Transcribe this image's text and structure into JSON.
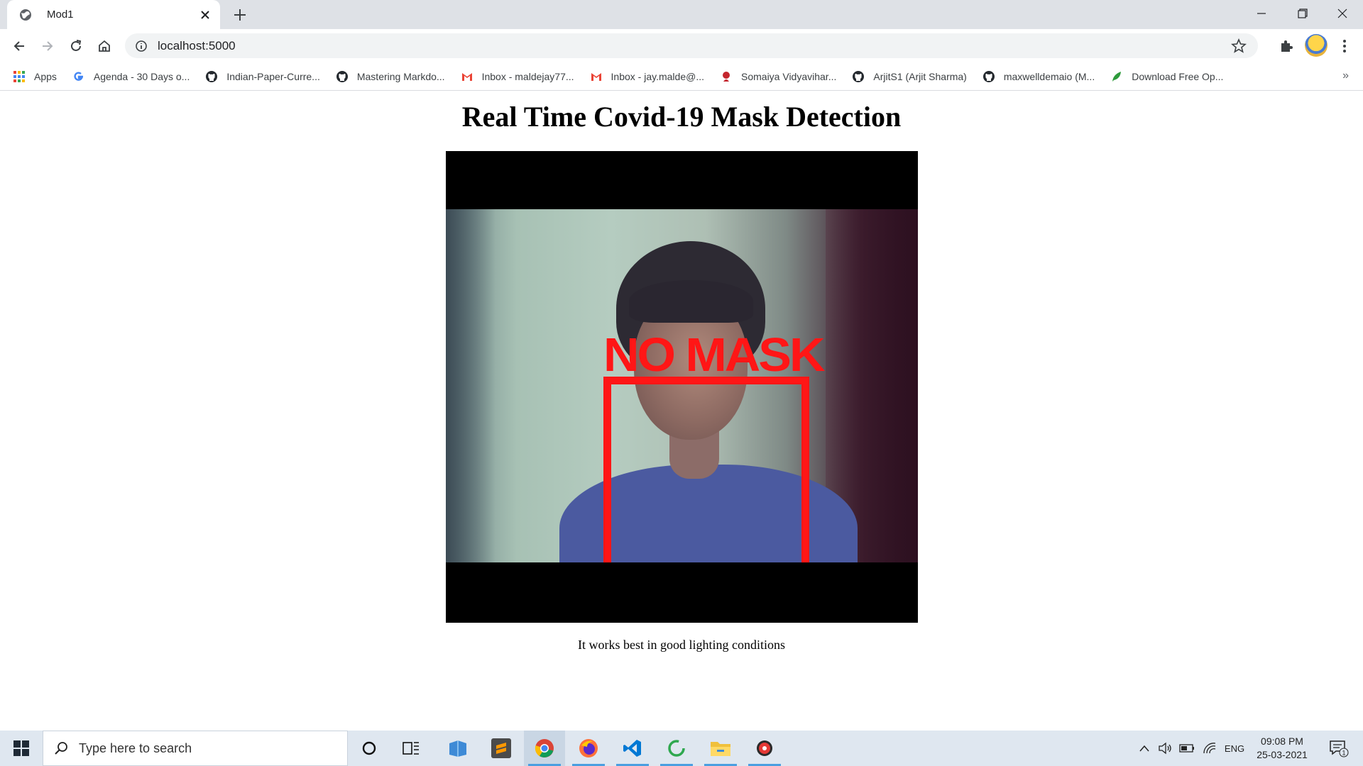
{
  "browser": {
    "tab_title": "Mod1",
    "url": "localhost:5000",
    "bookmarks": [
      {
        "label": "Apps",
        "icon": "apps-grid-icon"
      },
      {
        "label": "Agenda - 30 Days o...",
        "icon": "google-icon"
      },
      {
        "label": "Indian-Paper-Curre...",
        "icon": "github-icon"
      },
      {
        "label": "Mastering Markdo...",
        "icon": "github-icon"
      },
      {
        "label": "Inbox - maldejay77...",
        "icon": "gmail-icon"
      },
      {
        "label": "Inbox - jay.malde@...",
        "icon": "gmail-icon"
      },
      {
        "label": "Somaiya Vidyavihar...",
        "icon": "somaiya-icon"
      },
      {
        "label": "ArjitS1 (Arjit Sharma)",
        "icon": "github-icon"
      },
      {
        "label": "maxwelldemaio (M...",
        "icon": "github-icon"
      },
      {
        "label": "Download Free Op...",
        "icon": "leaf-icon"
      }
    ],
    "bookmarks_overflow": "»"
  },
  "page": {
    "title": "Real Time Covid-19 Mask Detection",
    "detection_label": "NO MASK",
    "caption": "It works best in good lighting conditions"
  },
  "taskbar": {
    "search_placeholder": "Type here to search",
    "language": "ENG",
    "time": "09:08 PM",
    "date": "25-03-2021",
    "notification_count": "1"
  },
  "colors": {
    "detection": "#ff1616",
    "tabstrip": "#dee1e6",
    "taskbar": "#dfe7f0"
  }
}
